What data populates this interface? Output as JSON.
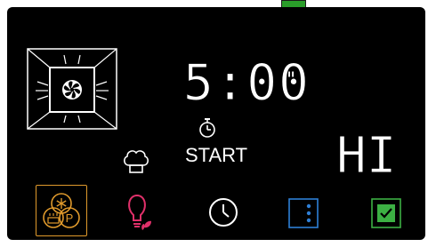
{
  "display": {
    "timer": "5:00",
    "timer_mark": "\"",
    "start_label": "START",
    "power_level": "HI"
  },
  "icons": {
    "oven": "oven-fan-icon",
    "stopwatch": "stopwatch-icon",
    "chef": "chef-hat-icon",
    "preset": "preset-programs-icon",
    "lamp": "lamp-icon",
    "clock": "clock-icon",
    "options": "options-icon",
    "confirm": "confirm-checkbox-icon"
  },
  "colors": {
    "background": "#000000",
    "text": "#ffffff",
    "preset_accent": "#e09a2c",
    "lamp_accent": "#e0306a",
    "leaf_accent": "#e0306a",
    "options_accent": "#2e7fd6",
    "confirm_accent": "#3cb043",
    "top_indicator": "#2a9d2a"
  }
}
